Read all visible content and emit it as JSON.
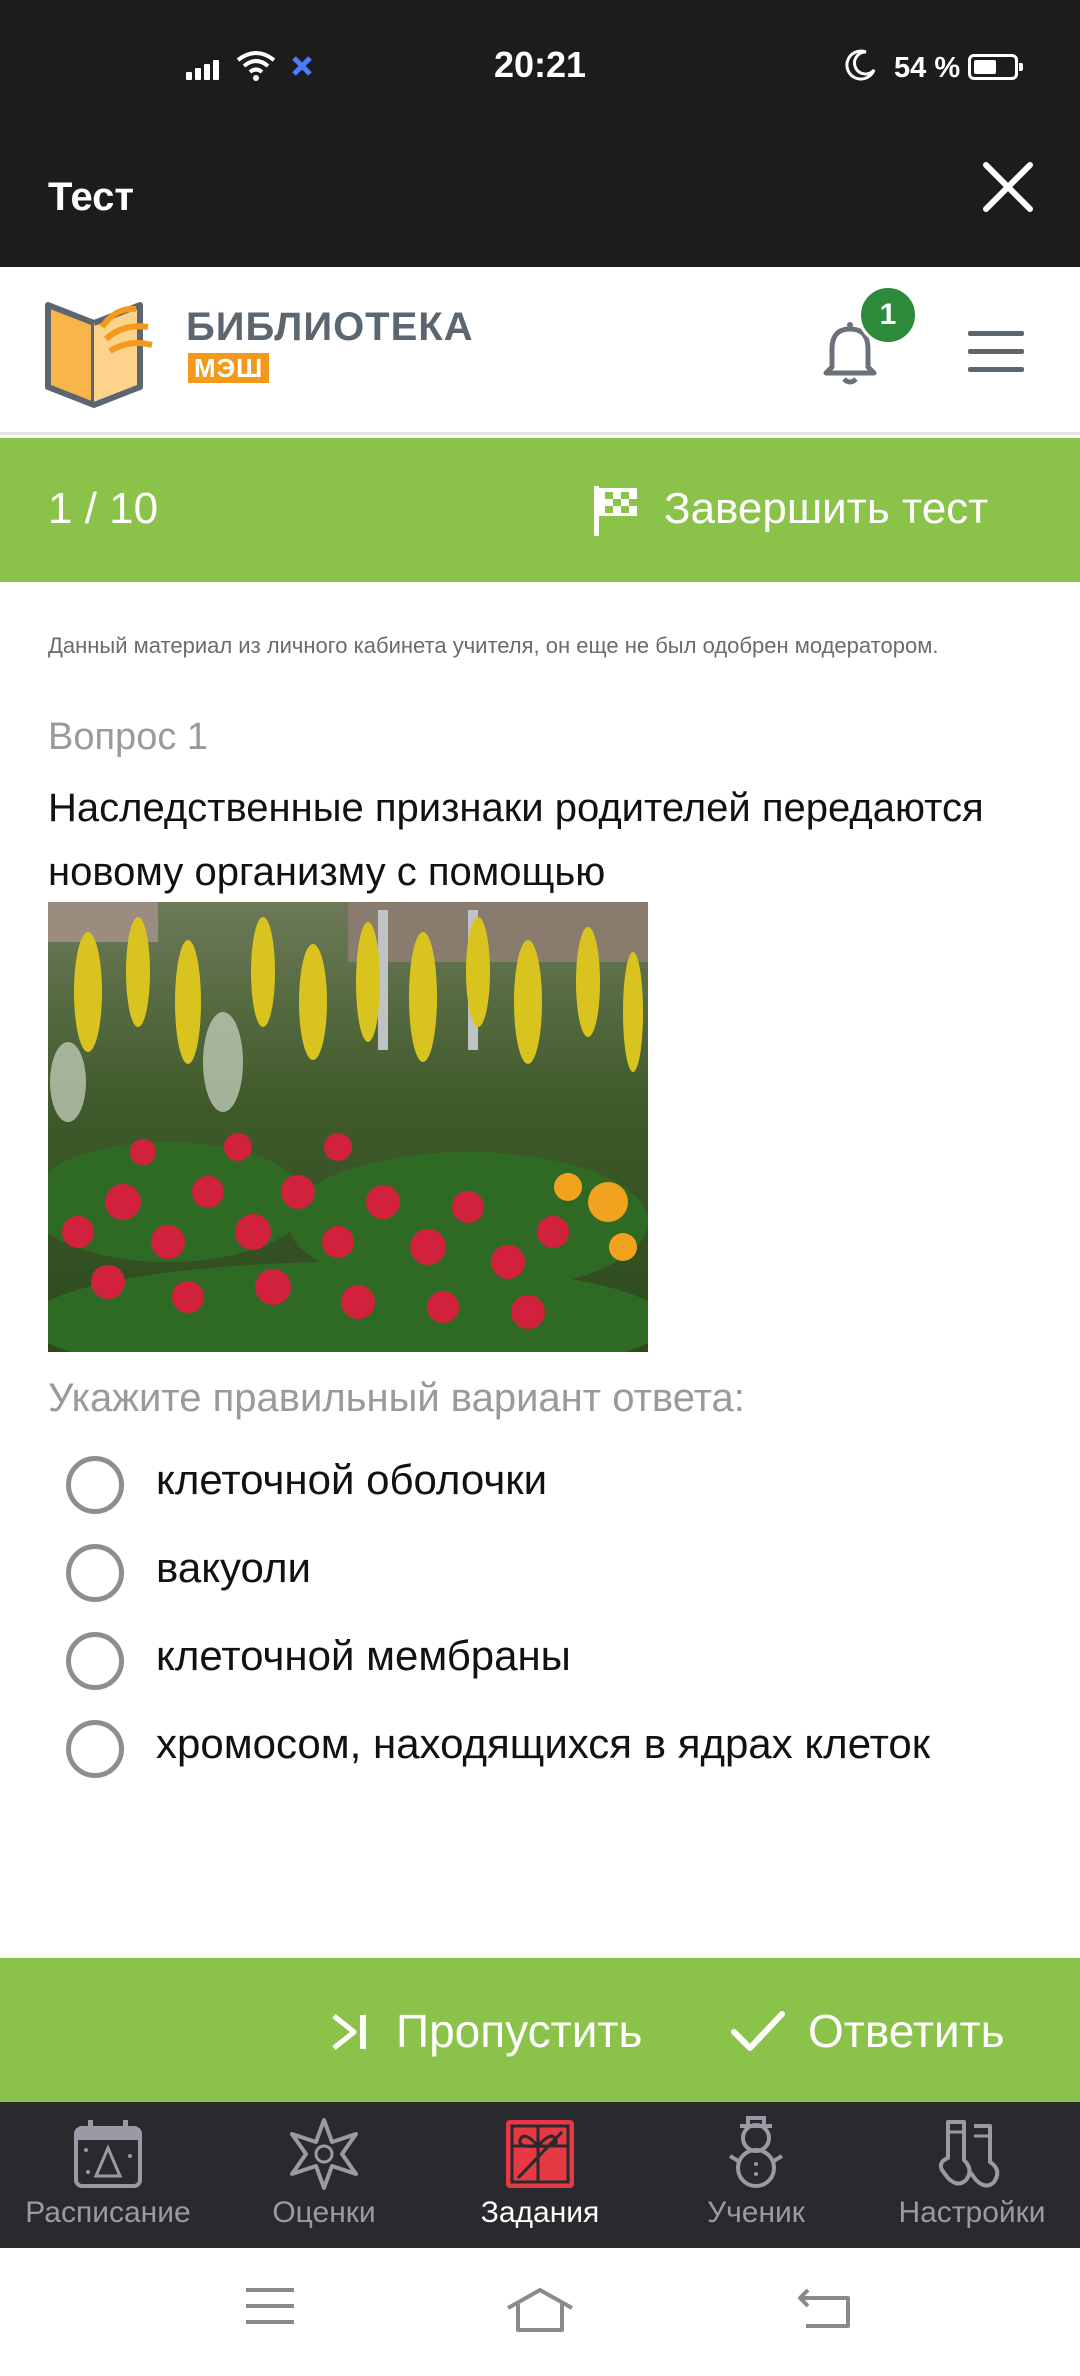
{
  "status_bar": {
    "time": "20:21",
    "battery": "54 %"
  },
  "title_bar": {
    "title": "Тест"
  },
  "library_header": {
    "logo_title": "БИБЛИОТЕКА",
    "logo_sub": "МЭШ",
    "notification_count": "1"
  },
  "progress": {
    "counter": "1 / 10",
    "finish_label": "Завершить тест"
  },
  "question": {
    "notice": "Данный материал из личного кабинета учителя, он еще не был одобрен модератором.",
    "number": "Вопрос 1",
    "text": "Наследственные признаки родителей передаются новому организму с помощью",
    "instruction": "Укажите правильный вариант ответа:",
    "options": [
      {
        "label": "клеточной оболочки"
      },
      {
        "label": "вакуоли"
      },
      {
        "label": "клеточной мембраны"
      },
      {
        "label": "хромосом, находящихся в ядрах клеток"
      }
    ]
  },
  "actions": {
    "skip_label": "Пропустить",
    "answer_label": "Ответить"
  },
  "bottom_nav": {
    "items": [
      {
        "label": "Расписание",
        "icon": "calendar-icon"
      },
      {
        "label": "Оценки",
        "icon": "star-icon"
      },
      {
        "label": "Задания",
        "icon": "gift-icon"
      },
      {
        "label": "Ученик",
        "icon": "snowman-icon"
      },
      {
        "label": "Настройки",
        "icon": "socks-icon"
      }
    ],
    "active_index": 2
  },
  "colors": {
    "accent_green": "#8bc34a",
    "badge_green": "#2e8b3b",
    "logo_orange": "#f39a1c",
    "nav_active_red": "#e53944",
    "dark_bar": "#1c1c1c"
  }
}
